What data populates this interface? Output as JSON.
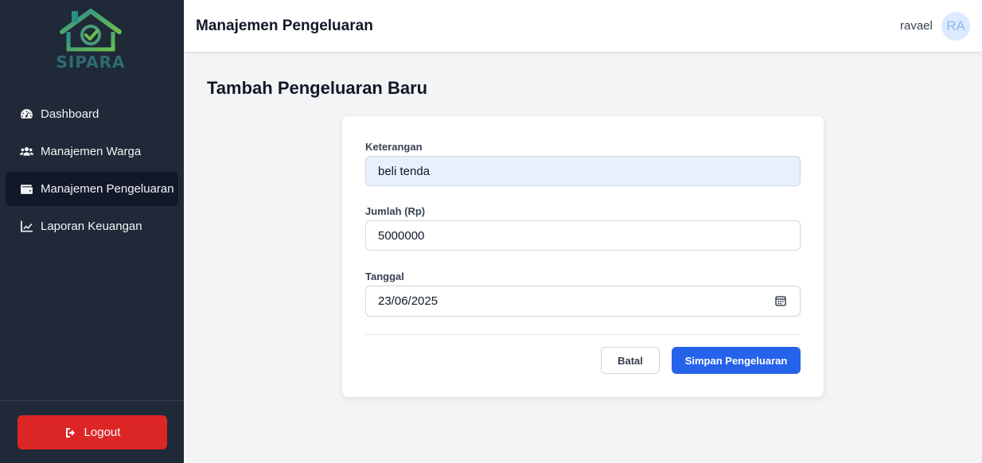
{
  "brand": {
    "name": "SIPARA"
  },
  "sidebar": {
    "items": [
      {
        "label": "Dashboard",
        "icon": "gauge-icon",
        "active": false
      },
      {
        "label": "Manajemen Warga",
        "icon": "users-icon",
        "active": false
      },
      {
        "label": "Manajemen Pengeluaran",
        "icon": "wallet-icon",
        "active": true
      },
      {
        "label": "Laporan Keuangan",
        "icon": "line-chart-icon",
        "active": false
      }
    ],
    "logout_label": "Logout"
  },
  "header": {
    "title": "Manajemen Pengeluaran",
    "username": "ravael",
    "avatar_initials": "RA"
  },
  "main": {
    "page_title": "Tambah Pengeluaran Baru",
    "form": {
      "keterangan": {
        "label": "Keterangan",
        "value": "beli tenda"
      },
      "jumlah": {
        "label": "Jumlah (Rp)",
        "value": "5000000"
      },
      "tanggal": {
        "label": "Tanggal",
        "value": "23/06/2025"
      },
      "cancel_label": "Batal",
      "submit_label": "Simpan Pengeluaran"
    }
  },
  "colors": {
    "sidebar_bg": "#1f2937",
    "active_item_bg": "#111827",
    "logout_red": "#dc2626",
    "primary_blue": "#2563eb"
  }
}
